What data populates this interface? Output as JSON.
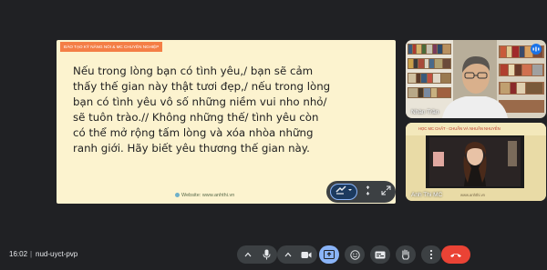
{
  "slide": {
    "tag": "ĐÀO TẠO KỸ NĂNG NÓI & MC CHUYÊN NGHIỆP",
    "body": "Nếu trong lòng bạn có tình yêu,/ bạn sẽ cảm thấy thế gian này thật tươi đẹp,/ nếu trong lòng bạn có tình yêu vô số những niềm vui nho nhỏ/ sẽ tuôn trào.// Không những thế/ tình yêu còn có thể mở rộng tấm lòng và xóa nhòa những ranh giới. Hãy biết yêu thương thế gian này.",
    "website": "Website: www.anhthi.vn"
  },
  "participants": [
    {
      "name": "Nhàn Trần",
      "bg": "#6a5a45"
    },
    {
      "name": "Anh Thi MC",
      "bg": "#e7d9a4"
    }
  ],
  "inner_slide": {
    "title": "HỌC MC CHẤT - CHUẨN VÀ NHUẦN NHUYỄN",
    "website": "www.anhthi.vn"
  },
  "bottom_bar": {
    "time": "16:02",
    "separator": "|",
    "meeting_code": "nud-uyct-pvp"
  },
  "icons": {
    "presentation_controls": [
      "annotate-icon",
      "zoom-icon",
      "fullscreen-icon"
    ],
    "toolbar": [
      "mic-icon",
      "more-options-up-icon",
      "camera-icon",
      "present-icon",
      "emoji-icon",
      "captions-icon",
      "raise-hand-icon",
      "more-vert-icon",
      "end-call-icon"
    ]
  },
  "colors": {
    "background": "#202124",
    "slide_bg": "#fcf3cf",
    "slide_tag": "#f47e46",
    "end_call": "#ea4335",
    "present_active": "#8ab4f8"
  }
}
